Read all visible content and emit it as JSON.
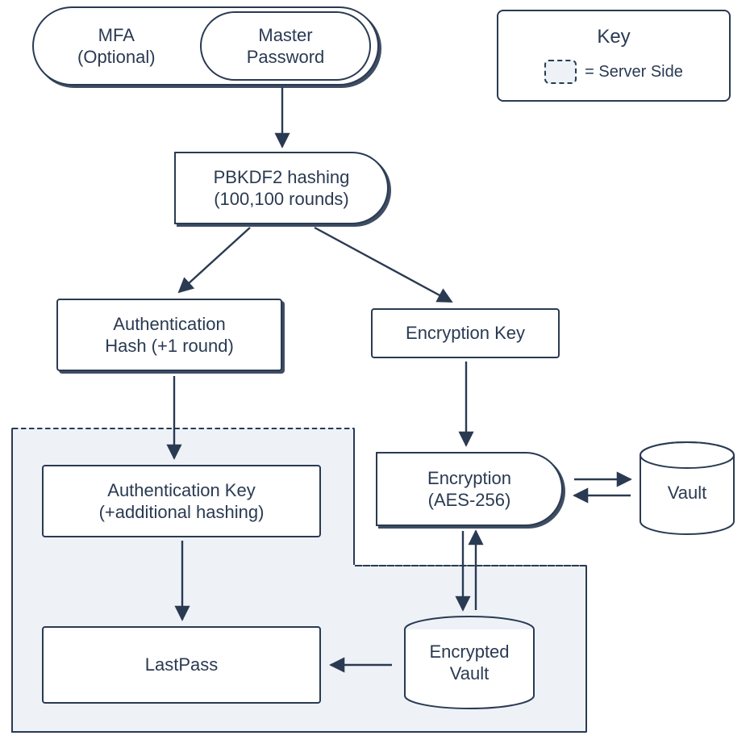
{
  "legend": {
    "title": "Key",
    "swatch_label": "= Server Side"
  },
  "nodes": {
    "mfa": "MFA\n(Optional)",
    "master_pw": "Master\nPassword",
    "pbkdf2": "PBKDF2 hashing\n(100,100 rounds)",
    "auth_hash": "Authentication\nHash (+1 round)",
    "enc_key": "Encryption Key",
    "auth_key": "Authentication Key\n(+additional hashing)",
    "encryption": "Encryption\n(AES-256)",
    "vault": "Vault",
    "enc_vault": "Encrypted\nVault",
    "lastpass": "LastPass"
  },
  "colors": {
    "ink": "#2a3a52",
    "region_fill": "#eef2f7"
  }
}
